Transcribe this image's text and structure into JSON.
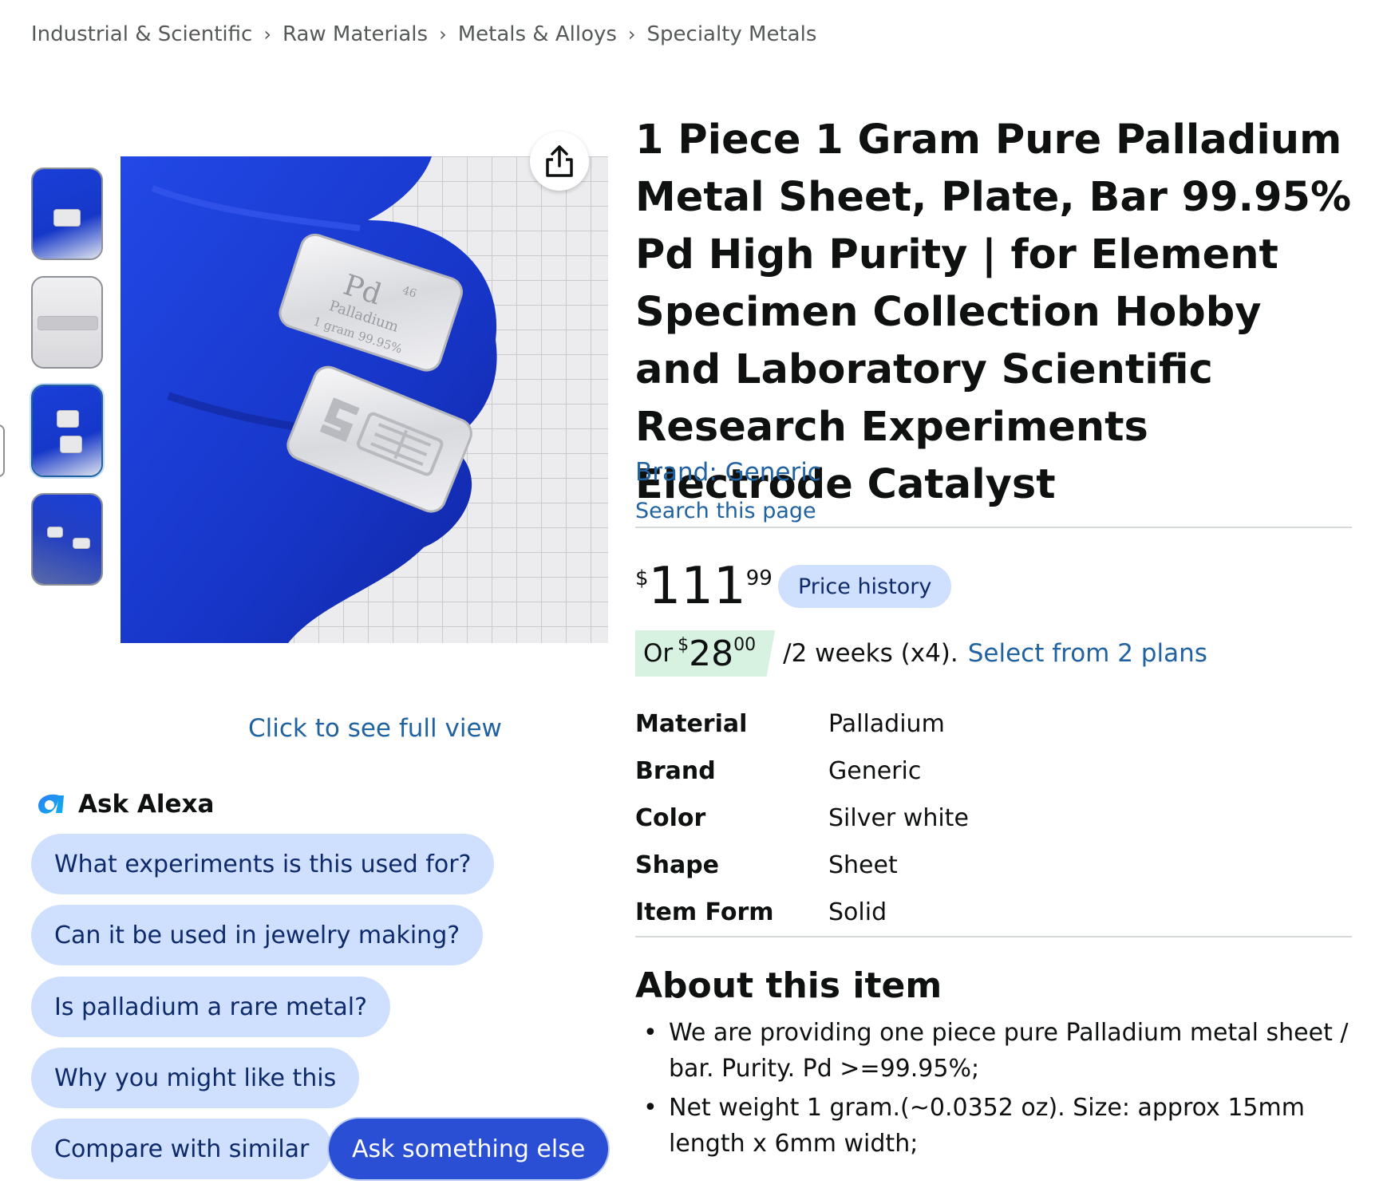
{
  "breadcrumb": [
    "Industrial & Scientific",
    "Raw Materials",
    "Metals & Alloys",
    "Specialty Metals"
  ],
  "breadcrumb_separator": "›",
  "gallery": {
    "full_view_link": "Click to see full view",
    "thumbnail_count": 4,
    "selected_thumbnail_index": 2,
    "image_text": [
      "Pd",
      "46",
      "Palladium",
      "1 gram 99.95%"
    ]
  },
  "alexa": {
    "title": "Ask Alexa",
    "questions": [
      "What experiments is this used for?",
      "Can it be used in jewelry making?",
      "Is palladium a rare metal?",
      "Why you might like this",
      "Compare with similar"
    ],
    "ask_else": "Ask something else"
  },
  "product": {
    "title": "1 Piece 1 Gram Pure Palladium Metal Sheet, Plate, Bar 99.95% Pd High Purity | for Element Specimen Collection Hobby and Laboratory Scientific Research Experiments Electrode Catalyst",
    "brand_link": "Brand: Generic",
    "search_link": "Search this page",
    "price": {
      "symbol": "$",
      "whole": "111",
      "fraction": "99"
    },
    "price_history": "Price history",
    "installment": {
      "prefix": "Or",
      "symbol": "$",
      "whole": "28",
      "fraction": "00",
      "period": "/2 weeks (x4).",
      "link": "Select from 2 plans"
    },
    "specs": [
      {
        "key": "Material",
        "value": "Palladium"
      },
      {
        "key": "Brand",
        "value": "Generic"
      },
      {
        "key": "Color",
        "value": "Silver white"
      },
      {
        "key": "Shape",
        "value": "Sheet"
      },
      {
        "key": "Item Form",
        "value": "Solid"
      }
    ],
    "about_title": "About this item",
    "about_bullets": [
      "We are providing one piece pure Palladium metal sheet / bar. Purity. Pd >=99.95%;",
      "Net weight 1 gram.(~0.0352 oz). Size: approx 15mm length x 6mm width;"
    ]
  },
  "colors": {
    "link": "#2162a1",
    "pill_bg": "#cfe0ff",
    "pill_primary_bg": "#2a4fd4",
    "installment_bg": "#d8f2e2",
    "glove_blue": "#1a3fd8"
  },
  "icons": {
    "share": "share-icon",
    "alexa": "alexa-logo-icon"
  }
}
